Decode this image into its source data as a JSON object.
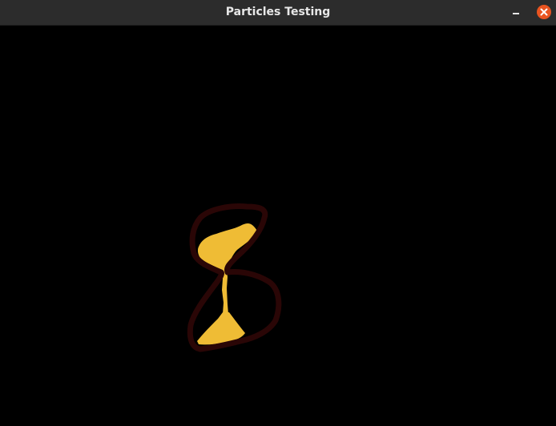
{
  "window": {
    "title": "Particles Testing",
    "controls": {
      "minimize_icon": "minimize-icon",
      "close_icon": "close-icon"
    }
  },
  "scene": {
    "outline_color": "#2a0606",
    "sand_color": "#efbc35",
    "background_color": "#000000"
  }
}
